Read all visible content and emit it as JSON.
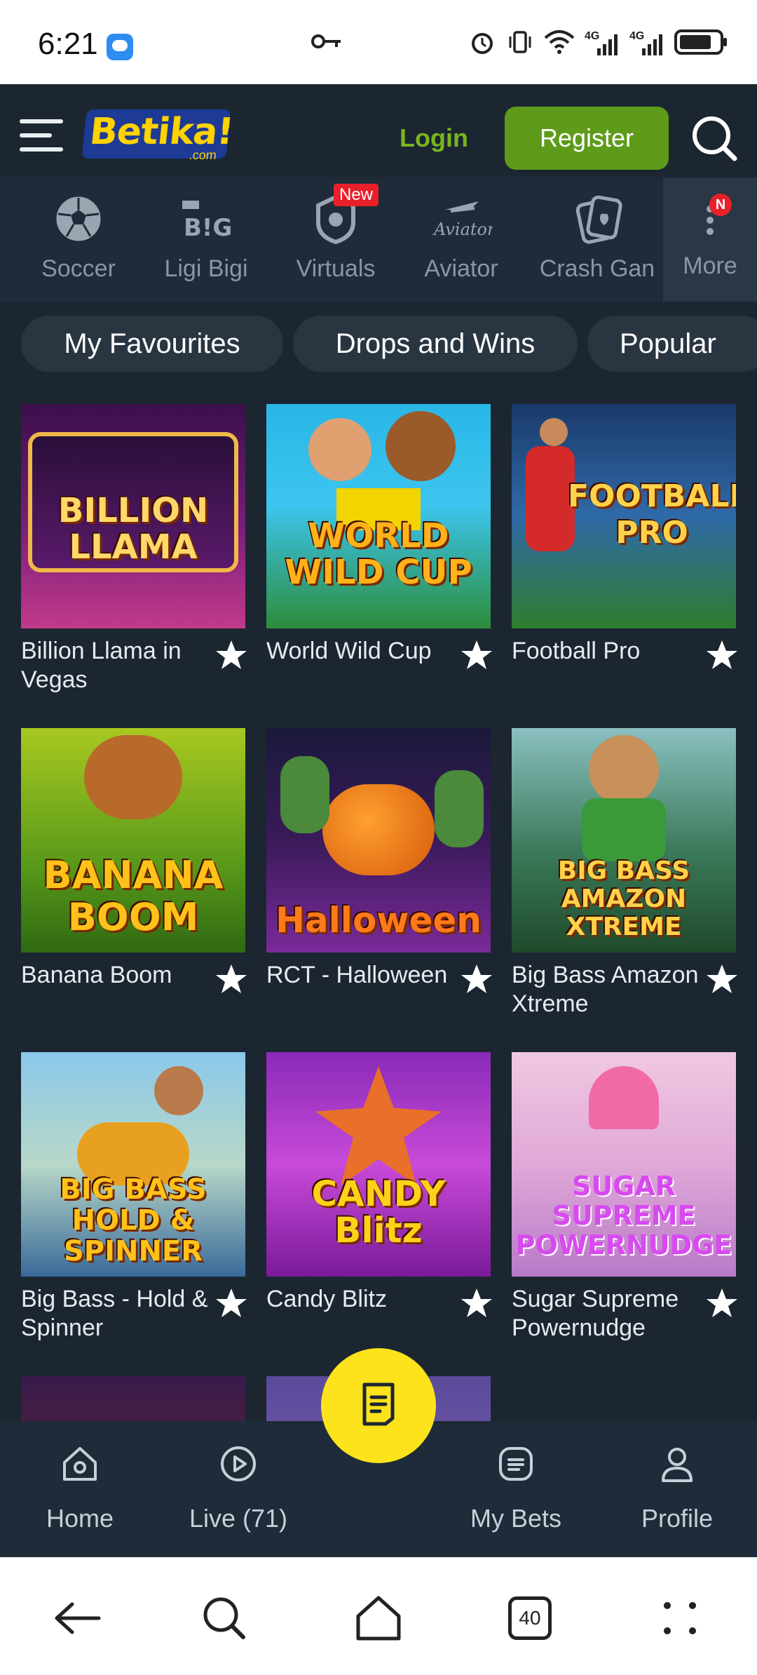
{
  "status_bar": {
    "time": "6:21",
    "icons": [
      "message-icon",
      "key-icon",
      "alarm-icon",
      "vibrate-icon",
      "wifi-icon",
      "signal-4g-icon",
      "signal-4g-icon",
      "battery-icon"
    ],
    "signal_label_1": "4G",
    "signal_label_2": "4G"
  },
  "header": {
    "logo_text": "Betika!",
    "logo_sub": ".com",
    "login_label": "Login",
    "register_label": "Register"
  },
  "categories": [
    {
      "label": "Soccer",
      "icon": "soccer-ball-icon"
    },
    {
      "label": "Ligi Bigi",
      "icon": "ligi-bigi-icon"
    },
    {
      "label": "Virtuals",
      "icon": "virtuals-icon",
      "badge": "New"
    },
    {
      "label": "Aviator",
      "icon": "aviator-icon"
    },
    {
      "label": "Crash Gan",
      "icon": "crash-games-icon"
    },
    {
      "label": "More",
      "icon": "more-dots-icon",
      "badge": "N"
    }
  ],
  "chips": [
    "My Favourites",
    "Drops and Wins",
    "Popular"
  ],
  "games": [
    {
      "name": "Billion Llama in Vegas",
      "art": "BILLION LLAMA"
    },
    {
      "name": "World Wild Cup",
      "art": "WORLD WILD CUP"
    },
    {
      "name": "Football Pro",
      "art": "FOOTBALL PRO"
    },
    {
      "name": "Banana Boom",
      "art": "BANANA BOOM"
    },
    {
      "name": "RCT - Halloween",
      "art": "Halloween"
    },
    {
      "name": "Big Bass Amazon Xtreme",
      "art": "BIG BASS AMAZON XTREME"
    },
    {
      "name": "Big Bass - Hold & Spinner",
      "art": "BIG BASS HOLD & SPINNER"
    },
    {
      "name": "Candy Blitz",
      "art": "CANDY Blitz"
    },
    {
      "name": "Sugar Supreme Powernudge",
      "art": "SUGAR SUPREME POWERNUDGE"
    }
  ],
  "bottom_nav": {
    "home": "Home",
    "live": "Live (71)",
    "my_bets": "My Bets",
    "profile": "Profile"
  },
  "system_nav": {
    "tabs_count": "40"
  },
  "colors": {
    "background": "#1b2631",
    "accent_green": "#5f9b1a",
    "login_green": "#7ab51d",
    "betslip_yellow": "#fde31b",
    "badge_red": "#e8202a"
  }
}
